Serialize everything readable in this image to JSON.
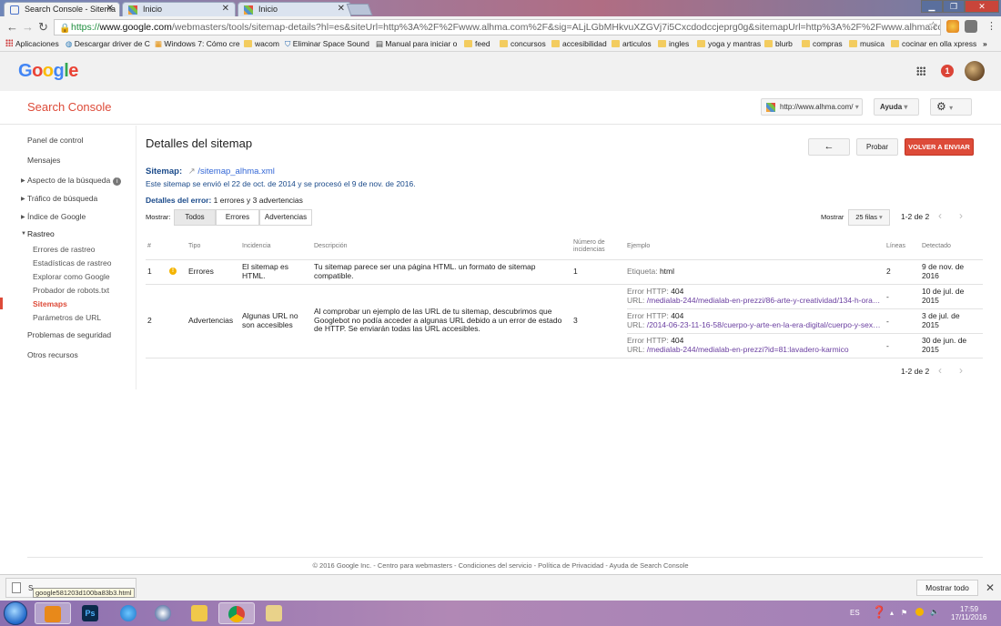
{
  "browser": {
    "tabs": [
      {
        "label": "Search Console - Sitema",
        "active": true
      },
      {
        "label": "Inicio",
        "active": false
      },
      {
        "label": "Inicio",
        "active": false
      }
    ],
    "url_https": "https://",
    "url_host": "www.google.com",
    "url_rest": "/webmasters/tools/sitemap-details?hl=es&siteUrl=http%3A%2F%2Fwww.alhma.com%2F&sig=ALjLGbMHkvuXZGVj7i5Cxcdodccjeprg0g&sitemapUrl=http%3A%2F%2Fwww.alhma.com%2Fsitemap_alhma.xml&",
    "bookmarks": [
      {
        "label": "Aplicaciones",
        "kind": "apps"
      },
      {
        "label": "Descargar driver de C",
        "kind": "site"
      },
      {
        "label": "Windows 7: Cómo cre",
        "kind": "site"
      },
      {
        "label": "wacom",
        "kind": "folder"
      },
      {
        "label": "Eliminar Space Sound",
        "kind": "site"
      },
      {
        "label": "Manual para iniciar o",
        "kind": "site"
      },
      {
        "label": "feed",
        "kind": "folder"
      },
      {
        "label": "concursos",
        "kind": "folder"
      },
      {
        "label": "accesibilidad",
        "kind": "folder"
      },
      {
        "label": "articulos",
        "kind": "folder"
      },
      {
        "label": "ingles",
        "kind": "folder"
      },
      {
        "label": "yoga y mantras",
        "kind": "folder"
      },
      {
        "label": "blurb",
        "kind": "folder"
      },
      {
        "label": "compras",
        "kind": "folder"
      },
      {
        "label": "musica",
        "kind": "folder"
      },
      {
        "label": "cocinar en olla xpress",
        "kind": "folder"
      }
    ],
    "bookmarks_more": "»"
  },
  "google": {
    "logo": "Google",
    "notification_count": "1"
  },
  "console": {
    "title": "Search Console",
    "site_selector": "http://www.alhma.com/",
    "help": "Ayuda"
  },
  "sidebar": {
    "items": [
      {
        "label": "Panel de control"
      },
      {
        "label": "Mensajes"
      },
      {
        "label": "Aspecto de la búsqueda"
      },
      {
        "label": "Tráfico de búsqueda"
      },
      {
        "label": "Índice de Google"
      },
      {
        "label": "Rastreo"
      },
      {
        "label": "Problemas de seguridad"
      },
      {
        "label": "Otros recursos"
      }
    ],
    "rastreo_sub": [
      {
        "label": "Errores de rastreo"
      },
      {
        "label": "Estadísticas de rastreo"
      },
      {
        "label": "Explorar como Google"
      },
      {
        "label": "Probador de robots.txt"
      },
      {
        "label": "Sitemaps"
      },
      {
        "label": "Parámetros de URL"
      }
    ]
  },
  "main": {
    "title": "Detalles del sitemap",
    "back_icon": "←",
    "test_label": "Probar",
    "resubmit_label": "VOLVER A ENVIAR",
    "sitemap_label": "Sitemap:",
    "sitemap_file": "/sitemap_alhma.xml",
    "sent_line": "Este sitemap se envió el 22 de oct. de 2014 y se procesó el 9 de nov. de 2016.",
    "error_details_label": "Detalles del error:",
    "error_details_value": " 1 errores y 3 advertencias",
    "show_label": "Mostrar:",
    "filters": [
      "Todos",
      "Errores",
      "Advertencias"
    ],
    "rows_label": "Mostrar",
    "rows_value": "25 filas",
    "pagination": "1-2 de 2"
  },
  "table": {
    "headers": {
      "num": "#",
      "type": "Tipo",
      "issue": "Incidencia",
      "desc": "Descripción",
      "count": "Número de incidencias",
      "example": "Ejemplo",
      "lines": "Líneas",
      "detected": "Detectado"
    },
    "rows": [
      {
        "num": "1",
        "type": "Errores",
        "issue": "El sitemap es HTML.",
        "desc": "Tu sitemap parece ser una página HTML. un formato de sitemap compatible.",
        "count": "1",
        "example_label": "Etiqueta:",
        "example_value": "html",
        "lines": "2",
        "detected": "9 de nov. de 2016"
      },
      {
        "num": "2",
        "type": "Advertencias",
        "issue": "Algunas URL no son accesibles",
        "desc": "Al comprobar un ejemplo de las URL de tu sitemap, descubrimos que Googlebot no podía acceder a algunas URL debido a un error de estado de HTTP. Se enviarán todas las URL accesibles.",
        "count": "3",
        "examples": [
          {
            "err_label": "Error HTTP:",
            "err_code": "404",
            "url_label": "URL:",
            "url": "/medialab-244/medialab-en-prezzi/86-arte-y-creatividad/134-h-orac...",
            "lines": "-",
            "detected": "10 de jul. de 2015"
          },
          {
            "err_label": "Error HTTP:",
            "err_code": "404",
            "url_label": "URL:",
            "url": "/2014-06-23-11-16-58/cuerpo-y-arte-en-la-era-digital/cuerpo-y-sexu...",
            "lines": "-",
            "detected": "3 de jul. de 2015"
          },
          {
            "err_label": "Error HTTP:",
            "err_code": "404",
            "url_label": "URL:",
            "url": "/medialab-244/medialab-en-prezzi?id=81:lavadero-karmico",
            "lines": "-",
            "detected": "30 de jun. de 2015"
          }
        ]
      }
    ],
    "pagination_bottom": "1-2 de 2"
  },
  "footer": {
    "text": "© 2016 Google Inc. - Centro para webmasters - Condiciones del servicio - Política de Privacidad - Ayuda de Search Console"
  },
  "downloads": {
    "file_visible": "S",
    "tooltip": "google581203d100ba83b3.html",
    "show_all": "Mostrar todo"
  },
  "taskbar": {
    "lang": "ES",
    "time": "17:59",
    "date": "17/11/2016"
  },
  "colors": {
    "accent_red": "#dd4b39",
    "link_blue": "#3367d6",
    "url_purple": "#6a3fa0"
  }
}
